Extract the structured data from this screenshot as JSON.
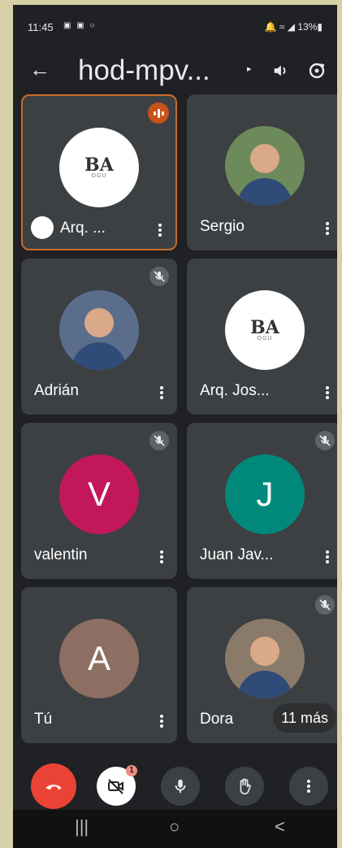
{
  "status": {
    "time": "11:45",
    "left_icons": "▣ ▣ ○",
    "right": "🔔 ≈ ◢ 13%▮"
  },
  "header": {
    "back_icon": "←",
    "title": "hod-mpv...",
    "chevron": "▸"
  },
  "tiles": [
    {
      "name": "Arq. ...",
      "avatar_type": "logo",
      "logo_text": "BA",
      "logo_sub": "OGU",
      "speaking": true,
      "muted": false
    },
    {
      "name": "Sergio",
      "avatar_type": "photo",
      "avatar_color": "#6d8a5a",
      "muted": false
    },
    {
      "name": "Adrián",
      "avatar_type": "photo",
      "avatar_color": "#5a6e8c",
      "muted": true
    },
    {
      "name": "Arq. Jos...",
      "avatar_type": "logo",
      "logo_text": "BA",
      "logo_sub": "OGU",
      "muted": false
    },
    {
      "name": "valentin",
      "avatar_type": "letter",
      "letter": "V",
      "avatar_color": "#c2185b",
      "muted": true
    },
    {
      "name": "Juan Jav...",
      "avatar_type": "letter",
      "letter": "J",
      "avatar_color": "#00897b",
      "muted": true
    },
    {
      "name": "Tú",
      "avatar_type": "letter",
      "letter": "A",
      "avatar_color": "#8d6e63",
      "muted": false
    },
    {
      "name": "Dora",
      "avatar_type": "photo",
      "avatar_color": "#8a7a6a",
      "muted": true,
      "more_label": "11 más"
    }
  ],
  "controls": {
    "cam_badge": "1"
  },
  "navbar": {
    "recents": "|||",
    "home": "○",
    "back": "<"
  }
}
